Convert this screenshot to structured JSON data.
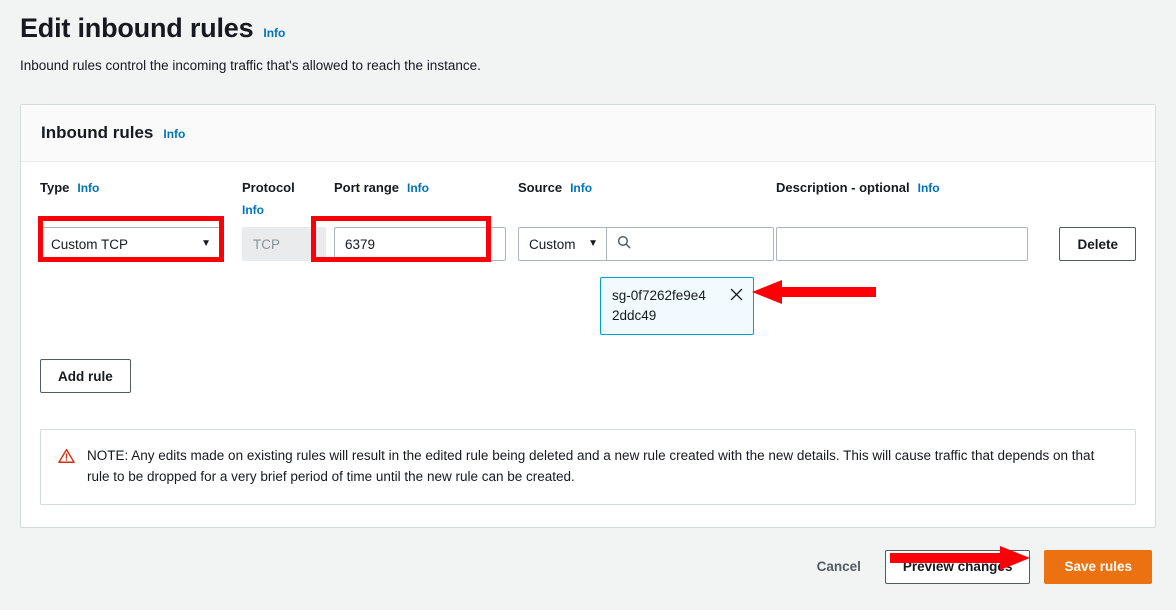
{
  "page": {
    "title": "Edit inbound rules",
    "title_info": "Info",
    "subtitle": "Inbound rules control the incoming traffic that's allowed to reach the instance."
  },
  "card": {
    "header_title": "Inbound rules",
    "header_info": "Info"
  },
  "columns": {
    "type": {
      "label": "Type",
      "info": "Info"
    },
    "protocol": {
      "label": "Protocol",
      "info": "Info"
    },
    "port_range": {
      "label": "Port range",
      "info": "Info"
    },
    "source": {
      "label": "Source",
      "info": "Info"
    },
    "description": {
      "label": "Description - optional",
      "info": "Info"
    }
  },
  "rule": {
    "type_value": "Custom TCP",
    "type_caret": "▼",
    "protocol_value": "TCP",
    "port_range_value": "6379",
    "source_select_value": "Custom",
    "source_caret": "▼",
    "source_search_value": "",
    "source_search_placeholder": "",
    "source_search_icon": "search-icon",
    "source_token": "sg-0f7262fe9e42ddc49",
    "source_token_close_icon": "close-icon",
    "description_value": "",
    "description_placeholder": "",
    "delete_label": "Delete"
  },
  "actions": {
    "add_rule_label": "Add rule",
    "cancel_label": "Cancel",
    "preview_label": "Preview changes",
    "save_label": "Save rules"
  },
  "note": {
    "icon": "warning-triangle-icon",
    "text": "NOTE: Any edits made on existing rules will result in the edited rule being deleted and a new rule created with the new details. This will cause traffic that depends on that rule to be dropped for a very brief period of time until the new rule can be created."
  },
  "annotations": {
    "highlight_type_field": "type-field-highlight",
    "highlight_port_field": "port-range-field-highlight",
    "arrow_to_token": "arrow-pointing-to-source-token",
    "arrow_to_save": "arrow-pointing-to-save-rules"
  },
  "colors": {
    "annotation_red": "#fb0007",
    "primary_orange": "#ec7211",
    "link_blue": "#0073bb",
    "token_border": "#00a1c9",
    "token_background": "#f1faff",
    "page_background": "#f2f3f3"
  }
}
